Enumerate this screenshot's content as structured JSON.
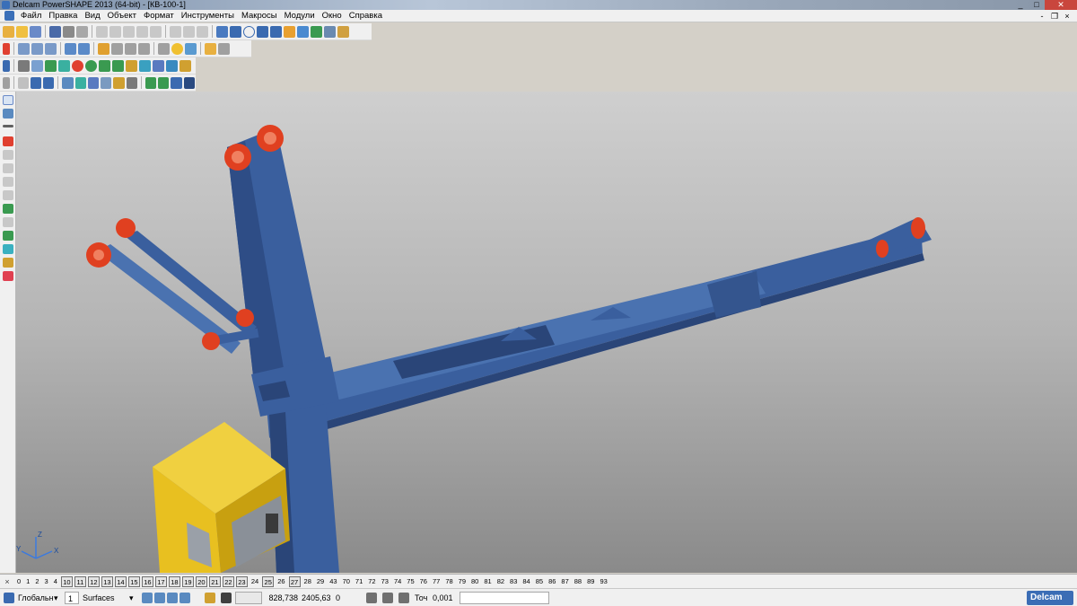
{
  "window": {
    "title": "Delcam PowerSHAPE 2013 (64-bit) - [КВ-100-1]",
    "controls": [
      "_",
      "□",
      "✕"
    ]
  },
  "menu": {
    "items": [
      "Файл",
      "Правка",
      "Вид",
      "Объект",
      "Формат",
      "Инструменты",
      "Макросы",
      "Модули",
      "Окно",
      "Справка"
    ],
    "mdi_controls": [
      "-",
      "❐",
      "×"
    ]
  },
  "levels": {
    "boxed": [
      "10",
      "11",
      "12",
      "13",
      "14",
      "15",
      "16",
      "17",
      "18",
      "19",
      "20",
      "21",
      "22",
      "23",
      "25",
      "27"
    ],
    "list": [
      "0",
      "1",
      "2",
      "3",
      "4",
      "10",
      "11",
      "12",
      "13",
      "14",
      "15",
      "16",
      "17",
      "18",
      "19",
      "20",
      "21",
      "22",
      "23",
      "24",
      "25",
      "26",
      "27",
      "28",
      "29",
      "43",
      "70",
      "71",
      "72",
      "73",
      "74",
      "75",
      "76",
      "77",
      "78",
      "79",
      "80",
      "81",
      "82",
      "83",
      "84",
      "85",
      "86",
      "87",
      "88",
      "89",
      "93"
    ]
  },
  "status": {
    "workplane": "Глобальн",
    "level_num": "1",
    "level_name": "Surfaces",
    "coord_x": "828,738",
    "coord_y": "2405,63",
    "coord_z": "0",
    "tolerance_label": "Точ",
    "tolerance_value": "0,001",
    "brand": "Delcam"
  },
  "viewport": {
    "axis_labels": [
      "X",
      "Y",
      "Z"
    ],
    "colors": {
      "structure": "#3a5f9e",
      "structure_dark": "#2a4578",
      "cabin": "#e8c020",
      "pulley": "#e04020"
    }
  }
}
